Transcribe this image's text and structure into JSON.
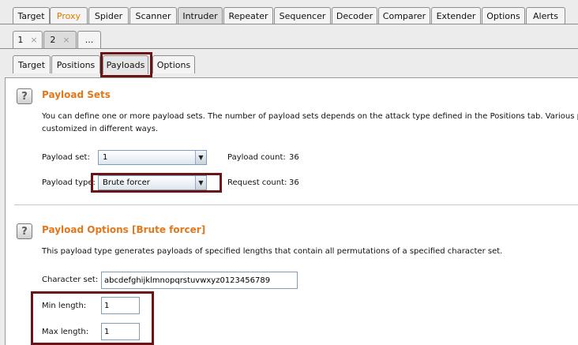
{
  "main_tabs": [
    "Target",
    "Proxy",
    "Spider",
    "Scanner",
    "Intruder",
    "Repeater",
    "Sequencer",
    "Decoder",
    "Comparer",
    "Extender",
    "Options",
    "Alerts"
  ],
  "attack_tabs": [
    {
      "label": "1",
      "close": "×"
    },
    {
      "label": "2",
      "close": "×"
    },
    {
      "label": "..."
    }
  ],
  "sub_tabs": [
    "Target",
    "Positions",
    "Payloads",
    "Options"
  ],
  "help_glyph": "?",
  "payload_sets": {
    "title": "Payload Sets",
    "description_line1": "You can define one or more payload sets. The number of payload sets depends on the attack type defined in the Positions tab. Various paylo",
    "description_line2": "customized in different ways.",
    "payload_set_label": "Payload set:",
    "payload_set_value": "1",
    "payload_count_label": "Payload count:",
    "payload_count_value": "36",
    "payload_type_label": "Payload type:",
    "payload_type_value": "Brute forcer",
    "request_count_label": "Request count:",
    "request_count_value": "36"
  },
  "payload_options": {
    "title": "Payload Options [Brute forcer]",
    "description": "This payload type generates payloads of specified lengths that contain all permutations of a specified character set.",
    "character_set_label": "Character set:",
    "character_set_value": "abcdefghijklmnopqrstuvwxyz0123456789",
    "min_length_label": "Min length:",
    "min_length_value": "1",
    "max_length_label": "Max length:",
    "max_length_value": "1"
  },
  "colors": {
    "accent": "#e3771b",
    "highlight_box": "#6b1416"
  }
}
